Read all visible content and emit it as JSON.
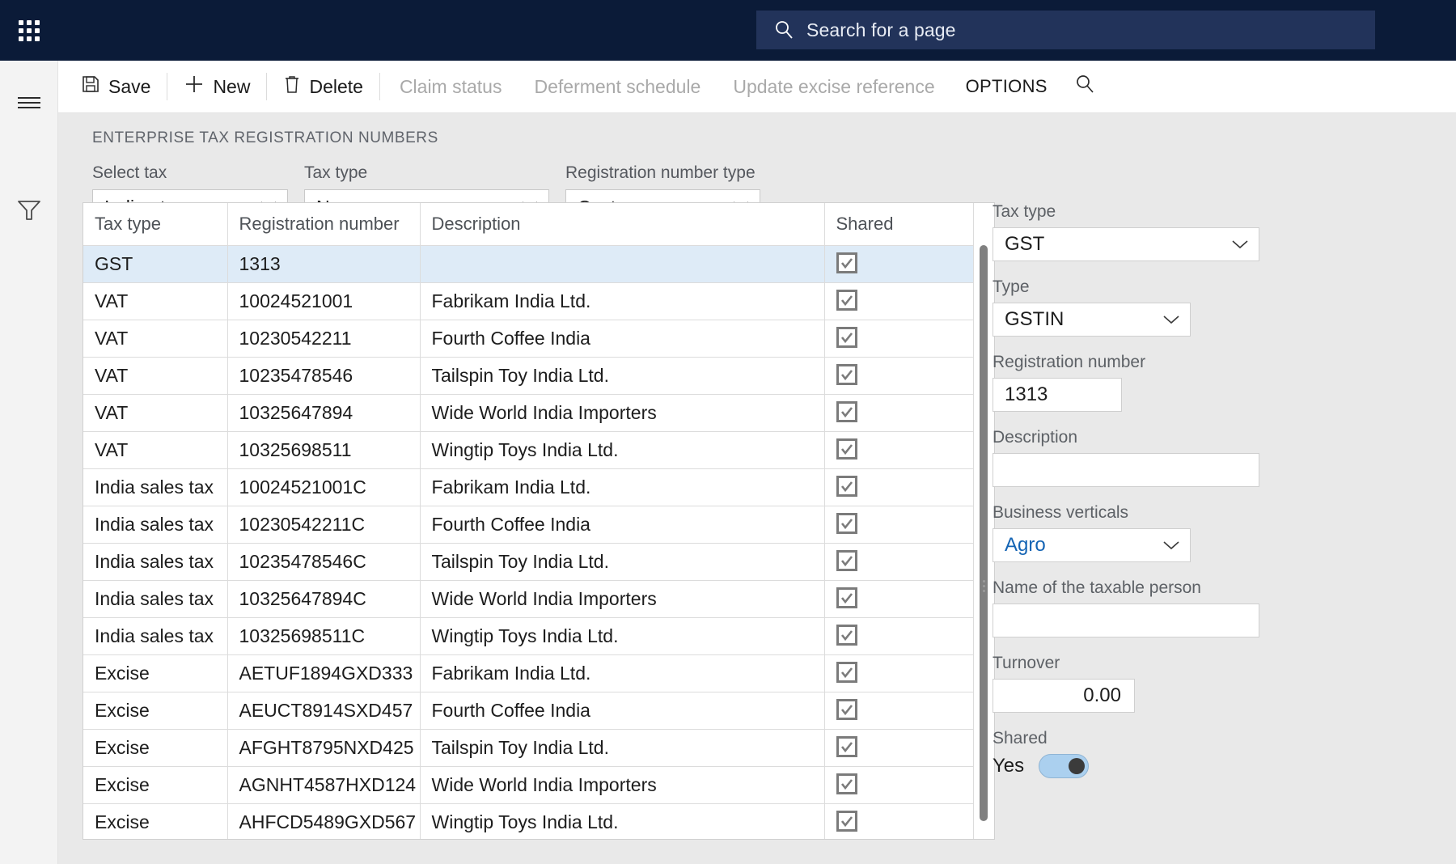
{
  "header": {
    "waffle_icon": "app-launcher-icon",
    "search": {
      "icon": "search-icon",
      "placeholder": "Search for a page",
      "value": ""
    }
  },
  "rail": {
    "items": [
      {
        "icon": "hamburger-menu-icon",
        "name": "navigation-toggle"
      },
      {
        "icon": "filter-funnel-icon",
        "name": "filter-pane"
      }
    ]
  },
  "commandbar": {
    "save": "Save",
    "new": "New",
    "delete": "Delete",
    "claim_status": "Claim status",
    "deferment_schedule": "Deferment schedule",
    "update_excise_reference": "Update excise reference",
    "options": "OPTIONS",
    "search_icon": "search-icon"
  },
  "page": {
    "title": "ENTERPRISE TAX REGISTRATION NUMBERS"
  },
  "filters": [
    {
      "label": "Select tax",
      "value": "Indirect"
    },
    {
      "label": "Tax type",
      "value": "None"
    },
    {
      "label": "Registration number type",
      "value": "Customers"
    }
  ],
  "grid": {
    "columns": [
      "Tax type",
      "Registration number",
      "Description",
      "Shared"
    ],
    "rows": [
      {
        "tax_type": "GST",
        "registration_number": "1313",
        "description": "",
        "shared": true,
        "selected": true
      },
      {
        "tax_type": "VAT",
        "registration_number": "10024521001",
        "description": "Fabrikam India Ltd.",
        "shared": true,
        "selected": false
      },
      {
        "tax_type": "VAT",
        "registration_number": "10230542211",
        "description": "Fourth Coffee India",
        "shared": true,
        "selected": false
      },
      {
        "tax_type": "VAT",
        "registration_number": "10235478546",
        "description": "Tailspin Toy India Ltd.",
        "shared": true,
        "selected": false
      },
      {
        "tax_type": "VAT",
        "registration_number": "10325647894",
        "description": "Wide World India Importers",
        "shared": true,
        "selected": false
      },
      {
        "tax_type": "VAT",
        "registration_number": "10325698511",
        "description": "Wingtip Toys India Ltd.",
        "shared": true,
        "selected": false
      },
      {
        "tax_type": "India sales tax",
        "registration_number": "10024521001C",
        "description": "Fabrikam India Ltd.",
        "shared": true,
        "selected": false
      },
      {
        "tax_type": "India sales tax",
        "registration_number": "10230542211C",
        "description": "Fourth Coffee India",
        "shared": true,
        "selected": false
      },
      {
        "tax_type": "India sales tax",
        "registration_number": "10235478546C",
        "description": "Tailspin Toy India Ltd.",
        "shared": true,
        "selected": false
      },
      {
        "tax_type": "India sales tax",
        "registration_number": "10325647894C",
        "description": "Wide World India Importers",
        "shared": true,
        "selected": false
      },
      {
        "tax_type": "India sales tax",
        "registration_number": "10325698511C",
        "description": "Wingtip Toys India Ltd.",
        "shared": true,
        "selected": false
      },
      {
        "tax_type": "Excise",
        "registration_number": "AETUF1894GXD333",
        "description": "Fabrikam India Ltd.",
        "shared": true,
        "selected": false
      },
      {
        "tax_type": "Excise",
        "registration_number": "AEUCT8914SXD457",
        "description": "Fourth Coffee India",
        "shared": true,
        "selected": false
      },
      {
        "tax_type": "Excise",
        "registration_number": "AFGHT8795NXD425",
        "description": "Tailspin Toy India Ltd.",
        "shared": true,
        "selected": false
      },
      {
        "tax_type": "Excise",
        "registration_number": "AGNHT4587HXD124",
        "description": "Wide World India Importers",
        "shared": true,
        "selected": false
      },
      {
        "tax_type": "Excise",
        "registration_number": "AHFCD5489GXD567",
        "description": "Wingtip Toys India Ltd.",
        "shared": true,
        "selected": false
      }
    ]
  },
  "detail": {
    "tax_type": {
      "label": "Tax type",
      "value": "GST"
    },
    "type": {
      "label": "Type",
      "value": "GSTIN"
    },
    "registration_number": {
      "label": "Registration number",
      "value": "1313"
    },
    "description": {
      "label": "Description",
      "value": ""
    },
    "business_verticals": {
      "label": "Business verticals",
      "value": "Agro"
    },
    "taxable_person_name": {
      "label": "Name of the taxable person",
      "value": ""
    },
    "turnover": {
      "label": "Turnover",
      "value": "0.00"
    },
    "shared": {
      "label": "Shared",
      "state_label": "Yes",
      "on": true
    }
  },
  "colors": {
    "topbar": "#0b1b38",
    "search_field": "#22335a",
    "row_selected": "#deebf7",
    "link": "#1464b4",
    "toggle_on": "#abd0ef",
    "work_background": "#e9e9e9"
  }
}
